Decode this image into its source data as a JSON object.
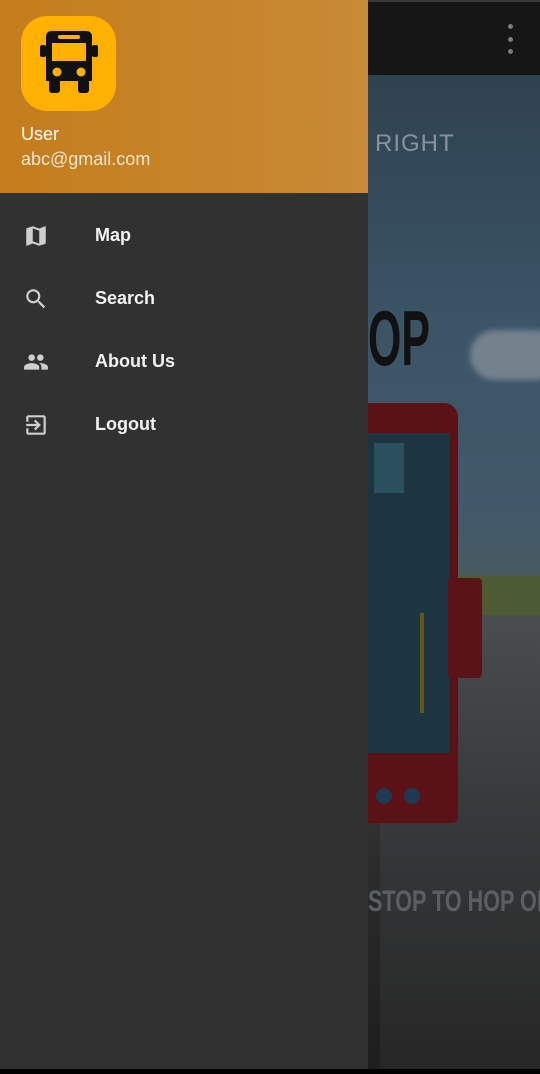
{
  "drawer": {
    "header": {
      "user_name": "User",
      "user_email": "abc@gmail.com",
      "logo_icon": "bus-icon",
      "background_color": "#c47d1c",
      "logo_color": "#ffb000"
    },
    "items": [
      {
        "label": "Map",
        "icon": "map-icon"
      },
      {
        "label": "Search",
        "icon": "search-icon"
      },
      {
        "label": "About Us",
        "icon": "people-icon"
      },
      {
        "label": "Logout",
        "icon": "logout-icon"
      }
    ],
    "background_color": "#313131"
  },
  "background": {
    "poster_text_top": "RIGHT",
    "poster_text_big": "OP",
    "poster_text_bottom": "STOP TO HOP ON",
    "overflow_icon": "more-vert-icon"
  }
}
